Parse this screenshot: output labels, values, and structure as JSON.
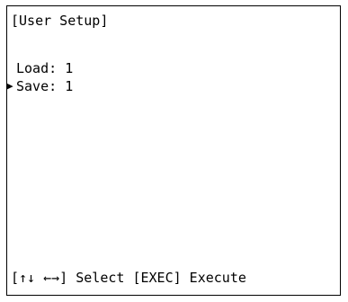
{
  "screen": {
    "title": "[User Setup]"
  },
  "menu": {
    "items": [
      {
        "label": "Load",
        "value": "1",
        "selected": false
      },
      {
        "label": "Save",
        "value": "1",
        "selected": true
      }
    ],
    "cursor_glyph": "▶"
  },
  "footer": {
    "hint": "[↑↓ ←→] Select [EXEC] Execute"
  }
}
